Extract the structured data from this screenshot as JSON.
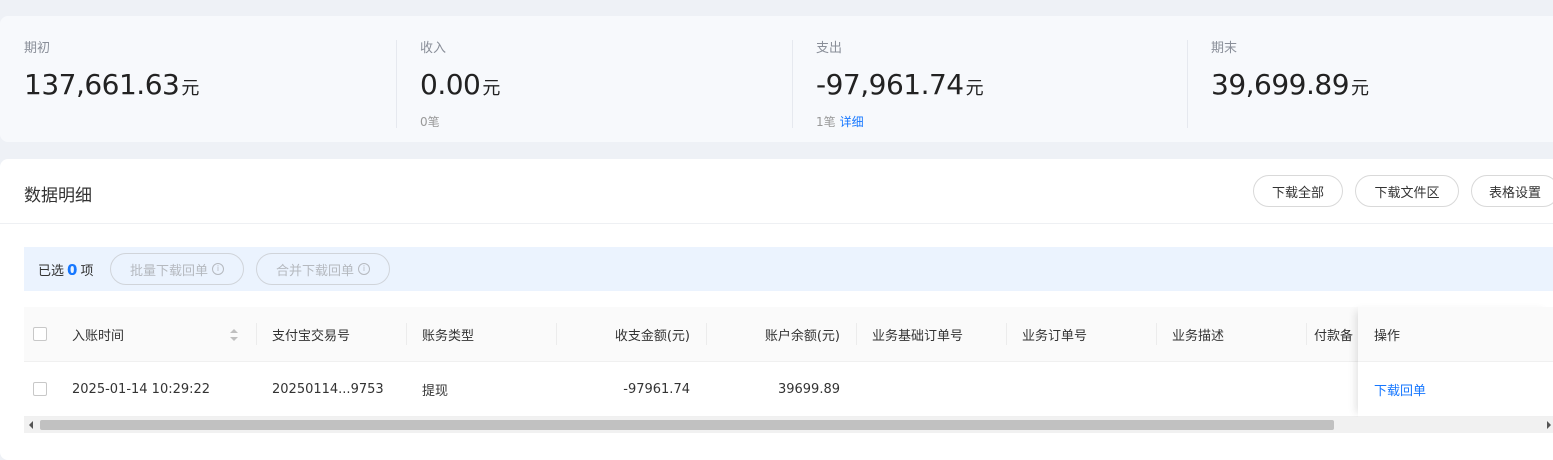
{
  "summary": {
    "opening": {
      "label": "期初",
      "amount": "137,661.63",
      "unit": "元"
    },
    "income": {
      "label": "收入",
      "amount": "0.00",
      "unit": "元",
      "count": "0笔"
    },
    "expense": {
      "label": "支出",
      "amount": "-97,961.74",
      "unit": "元",
      "count": "1笔",
      "detail_link": "详细"
    },
    "closing": {
      "label": "期末",
      "amount": "39,699.89",
      "unit": "元"
    }
  },
  "panel": {
    "title": "数据明细",
    "buttons": {
      "download_all": "下载全部",
      "download_area": "下载文件区",
      "table_settings": "表格设置"
    }
  },
  "selection": {
    "prefix": "已选",
    "count": "0",
    "suffix": "项",
    "batch_download": "批量下载回单",
    "merge_download": "合并下载回单",
    "info_icon": "info-circle-icon"
  },
  "table": {
    "columns": [
      "入账时间",
      "支付宝交易号",
      "账务类型",
      "收支金额(元)",
      "账户余额(元)",
      "业务基础订单号",
      "业务订单号",
      "业务描述",
      "付款备"
    ],
    "action_column": "操作",
    "rows": [
      {
        "time": "2025-01-14 10:29:22",
        "trade_no": "20250114...9753",
        "type": "提现",
        "amount": "-97961.74",
        "balance": "39699.89",
        "base_order": "",
        "order": "",
        "desc": "",
        "payer_note": "",
        "action": "下载回单"
      }
    ]
  },
  "colors": {
    "accent": "#1677ff",
    "page_bg": "#eef1f6"
  }
}
